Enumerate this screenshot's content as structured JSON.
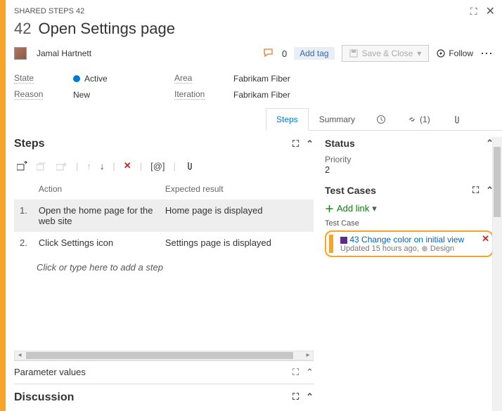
{
  "breadcrumb": "SHARED STEPS 42",
  "item": {
    "id": "42",
    "title": "Open Settings page"
  },
  "assignee": "Jamal Hartnett",
  "discussion_count": "0",
  "add_tag_label": "Add tag",
  "save_label": "Save & Close",
  "follow_label": "Follow",
  "fields": {
    "state_label": "State",
    "state_value": "Active",
    "reason_label": "Reason",
    "reason_value": "New",
    "area_label": "Area",
    "area_value": "Fabrikam Fiber",
    "iteration_label": "Iteration",
    "iteration_value": "Fabrikam Fiber"
  },
  "tabs": {
    "steps": "Steps",
    "summary": "Summary",
    "links": "(1)"
  },
  "steps_section": {
    "heading": "Steps",
    "col_action": "Action",
    "col_expected": "Expected result",
    "rows": [
      {
        "num": "1.",
        "action": "Open the home page for the web site",
        "expected": "Home page is displayed"
      },
      {
        "num": "2.",
        "action": "Click Settings icon",
        "expected": "Settings page is displayed"
      }
    ],
    "placeholder": "Click or type here to add a step",
    "param_values": "Parameter values"
  },
  "status_section": {
    "heading": "Status",
    "priority_label": "Priority",
    "priority_value": "2"
  },
  "testcases_section": {
    "heading": "Test Cases",
    "add_link": "Add link",
    "group_label": "Test Case",
    "linked": {
      "id": "43",
      "title": "Change color on initial view",
      "updated": "Updated 15 hours ago,",
      "state": "Design"
    }
  },
  "discussion_heading": "Discussion"
}
